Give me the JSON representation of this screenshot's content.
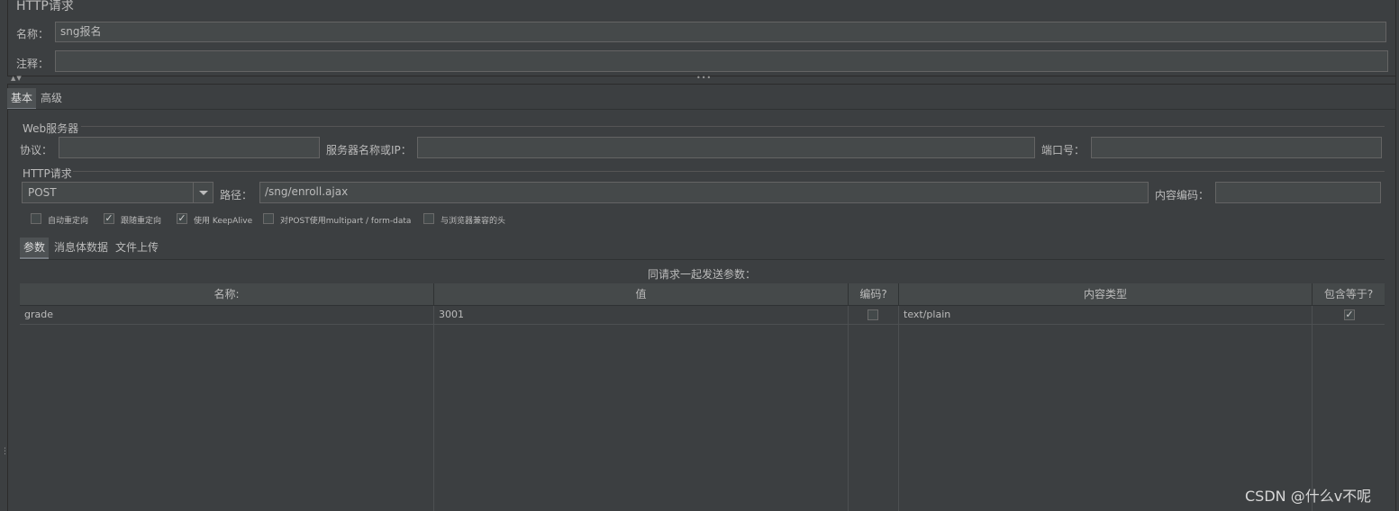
{
  "panel_title": "HTTP请求",
  "name_label": "名称：",
  "name_value": "sng报名",
  "comment_label": "注释：",
  "comment_value": "",
  "collapse_arrows": "▲▼",
  "divider_dots": "•••",
  "tabs": [
    {
      "label": "基本",
      "active": true
    },
    {
      "label": "高级",
      "active": false
    }
  ],
  "web_server": {
    "title": "Web服务器",
    "protocol_label": "协议：",
    "protocol_value": "",
    "server_label": "服务器名称或IP：",
    "server_value": "",
    "port_label": "端口号：",
    "port_value": ""
  },
  "http_request": {
    "title": "HTTP请求",
    "method": "POST",
    "path_label": "路径：",
    "path_value": "/sng/enroll.ajax",
    "encoding_label": "内容编码：",
    "encoding_value": ""
  },
  "options": [
    {
      "label": "自动重定向",
      "checked": false
    },
    {
      "label": "跟随重定向",
      "checked": true
    },
    {
      "label": "使用 KeepAlive",
      "checked": true
    },
    {
      "label": "对POST使用multipart / form-data",
      "checked": false
    },
    {
      "label": "与浏览器兼容的头",
      "checked": false
    }
  ],
  "sub_tabs": [
    {
      "label": "参数",
      "active": true
    },
    {
      "label": "消息体数据",
      "active": false
    },
    {
      "label": "文件上传",
      "active": false
    }
  ],
  "params_caption": "同请求一起发送参数：",
  "table": {
    "headers": [
      "名称:",
      "值",
      "编码?",
      "内容类型",
      "包含等于?"
    ],
    "rows": [
      {
        "name": "grade",
        "value": "3001",
        "encode": false,
        "content_type": "text/plain",
        "include_equals": true
      }
    ]
  },
  "check_glyph": "✓",
  "watermark": "CSDN @什么v不呢",
  "colors": {
    "background": "#3c3f41",
    "field": "#45494a",
    "border": "#646464",
    "text": "#bbbbbb"
  }
}
